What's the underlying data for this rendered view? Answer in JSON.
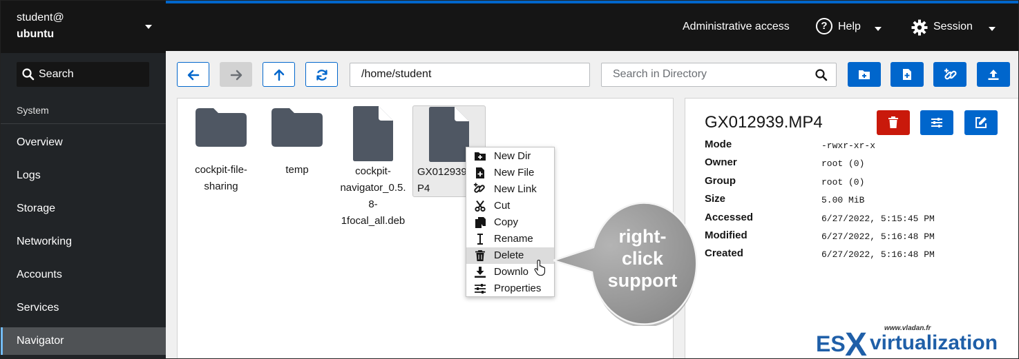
{
  "host": {
    "user": "student@",
    "hostname": "ubuntu"
  },
  "sidebar": {
    "search_label": "Search",
    "section_label": "System",
    "items": [
      {
        "label": "Overview",
        "active": false
      },
      {
        "label": "Logs",
        "active": false
      },
      {
        "label": "Storage",
        "active": false
      },
      {
        "label": "Networking",
        "active": false
      },
      {
        "label": "Accounts",
        "active": false
      },
      {
        "label": "Services",
        "active": false
      },
      {
        "label": "Navigator",
        "active": true
      }
    ]
  },
  "topbar": {
    "admin_label": "Administrative access",
    "help_label": "Help",
    "session_label": "Session"
  },
  "toolbar": {
    "path": "/home/student",
    "search_placeholder": "Search in Directory",
    "nav_icons": [
      "arrow-left-icon",
      "arrow-right-icon",
      "arrow-up-icon",
      "refresh-icon"
    ],
    "action_icons": [
      "new-folder-icon",
      "new-file-icon",
      "new-link-icon",
      "upload-icon"
    ]
  },
  "files": [
    {
      "name": "cockpit-file-sharing",
      "display": "cockpit-file-\nsharing",
      "type": "folder"
    },
    {
      "name": "temp",
      "display": "temp",
      "type": "folder"
    },
    {
      "name": "cockpit-navigator_0.5.8-1focal_all.deb",
      "display": "cockpit-\nnavigator_0.5.\n8-\n1focal_all.deb",
      "type": "file"
    },
    {
      "name": "GX012939.MP4",
      "display": "GX012939\nP4",
      "type": "file",
      "selected": true
    }
  ],
  "context_menu": {
    "items": [
      {
        "label": "New Dir",
        "icon": "new-folder-icon"
      },
      {
        "label": "New File",
        "icon": "new-file-icon"
      },
      {
        "label": "New Link",
        "icon": "new-link-icon"
      },
      {
        "label": "Cut",
        "icon": "scissors-icon"
      },
      {
        "label": "Copy",
        "icon": "copy-icon"
      },
      {
        "label": "Rename",
        "icon": "text-cursor-icon"
      },
      {
        "label": "Delete",
        "icon": "trash-icon",
        "highlighted": true
      },
      {
        "label": "Downlo",
        "icon": "download-icon"
      },
      {
        "label": "Properties",
        "icon": "sliders-icon"
      }
    ]
  },
  "details": {
    "filename": "GX012939.MP4",
    "properties": [
      {
        "label": "Mode",
        "value": "-rwxr-xr-x"
      },
      {
        "label": "Owner",
        "value": "root (0)"
      },
      {
        "label": "Group",
        "value": "root (0)"
      },
      {
        "label": "Size",
        "value": "5.00 MiB"
      },
      {
        "label": "Accessed",
        "value": "6/27/2022, 5:15:45 PM"
      },
      {
        "label": "Modified",
        "value": "6/27/2022, 5:16:48 PM"
      },
      {
        "label": "Created",
        "value": "6/27/2022, 5:16:48 PM"
      }
    ],
    "colors": {
      "delete": "#c9190b",
      "edit": "#0066cc"
    }
  },
  "callout": {
    "line1": "right-",
    "line2": "click",
    "line3": "support"
  },
  "watermark": {
    "site": "www.vladan.fr",
    "es": "ES",
    "x": "X",
    "virt": "virtualization"
  }
}
